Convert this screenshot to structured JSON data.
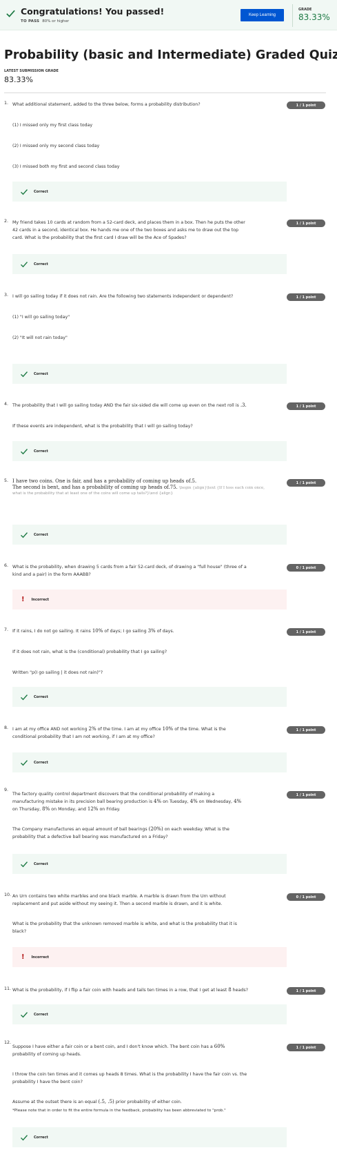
{
  "banner": {
    "title": "Congratulations! You passed!",
    "to_pass_label": "TO PASS",
    "to_pass_value": "80% or higher",
    "button": "Keep Learning",
    "grade_label": "GRADE",
    "grade_value": "83.33%"
  },
  "quiz": {
    "title": "Probability (basic and Intermediate) Graded Quiz",
    "latest_label": "LATEST SUBMISSION GRADE",
    "latest_value": "83.33%"
  },
  "labels": {
    "correct": "Correct",
    "incorrect": "Incorrect"
  },
  "questions": [
    {
      "num": "1.",
      "badge": "1 / 1 point",
      "lines": [
        "What additional statement, added to the three below, forms a probability distribution?",
        "(1) I missed only my first class today",
        "(2) I missed only my second class today",
        "(3) I missed both my first and second class today"
      ],
      "result": "correct"
    },
    {
      "num": "2.",
      "badge": "1 / 1 point",
      "lines": [
        "My friend takes 10 cards at random from a 52-card deck, and places them in a box. Then he puts the other",
        "42 cards in a second, identical box. He hands me one of the two boxes and asks me to draw out the top",
        "card. What is the probability that the first card I draw will be the Ace of Spades?"
      ],
      "result": "correct"
    },
    {
      "num": "3.",
      "badge": "1 / 1 point",
      "lines": [
        "I will go sailing today if it does not rain. Are the following two statements independent or dependent?",
        "(1) \"I will go sailing today\"",
        "(2) \"It will not rain today\""
      ],
      "result": "correct"
    },
    {
      "num": "4.",
      "badge": "1 / 1 point",
      "lines": [
        "The probability that I will go sailing today AND the fair six-sided die will come up even on the next roll is",
        ".3.",
        "If these events are independent, what is the probability that I will go sailing today?"
      ],
      "result": "correct"
    },
    {
      "num": "5.",
      "badge": "1 / 1 point",
      "lines": [
        "I have two coins. One is fair, and has a probability of coming up heads of",
        ".5.",
        "The second is bent, and has a probability of coming up heads of",
        ".75.",
        "\\begin {align}\\text {If I toss each coin once,",
        "what is the probability that at least one of the coins will come up tails?}\\end {align}"
      ],
      "result": "correct"
    },
    {
      "num": "6.",
      "badge": "0 / 1 point",
      "lines": [
        "What is the probability, when drawing 5 cards from a fair 52-card deck, of drawing a \"full house\" (three of a",
        "kind and a pair) in the form AAABB?"
      ],
      "result": "incorrect"
    },
    {
      "num": "7.",
      "badge": "1 / 1 point",
      "lines": [
        "If it rains, I do not go sailing. It rains",
        "10%",
        "of days; I go sailing",
        "3%",
        "of days.",
        "If it does not rain, what is the (conditional) probability that I go sailing?",
        "Written \"p(I go sailing | it does not rain)\"?"
      ],
      "result": "correct"
    },
    {
      "num": "8.",
      "badge": "1 / 1 point",
      "lines": [
        "I am at my office AND not working",
        "2%",
        "of the time. I am at my office",
        "10%",
        "of the time. What is the",
        "conditional probability that I am not working, if I am at my office?"
      ],
      "result": "correct"
    },
    {
      "num": "9.",
      "badge": "1 / 1 point",
      "lines": [
        "The factory quality control department discovers that the conditional probability of making a",
        "manufacturing mistake in its precision ball bearing production is",
        "4%",
        "on Tuesday,",
        "4%",
        "on Wednesday,",
        "4%",
        "on Thursday,",
        "8%",
        "on Monday, and",
        "12%",
        "on Friday.",
        "The Company manufactures an equal amount of ball bearings",
        "(20%)",
        "on each weekday. What is the",
        "probability that a defective ball bearing was manufactured on a Friday?"
      ],
      "result": "correct"
    },
    {
      "num": "10.",
      "badge": "0 / 1 point",
      "lines": [
        "An Urn contains two white marbles and one black marble. A marble is drawn from the Urn without",
        "replacement and put aside without my seeing it. Then a second marble is drawn, and it is white.",
        "What is the probability that the unknown removed marble is white, and what is the probability that it is",
        "black?"
      ],
      "result": "incorrect"
    },
    {
      "num": "11.",
      "badge": "1 / 1 point",
      "lines": [
        "What is the probability, if I flip a fair coin with heads and tails ten times in a row, that I get at least",
        "8",
        "heads?"
      ],
      "result": "correct"
    },
    {
      "num": "12.",
      "badge": "1 / 1 point",
      "lines": [
        "Suppose I have either a fair coin or a bent coin, and I don't know which. The bent coin has a",
        "60%",
        "probability of coming up heads.",
        "I throw the coin ten times and it comes up heads 8 times. What is the probability I have the fair coin vs. the",
        "probability I have the bent coin?",
        "Assume at the outset there is an equal",
        "(.5, .5)",
        "prior probability of either coin.",
        "*Please note that in order to fit the entire formula in the feedback, probability has been abbreviated to \"prob.\""
      ],
      "result": "correct"
    }
  ],
  "colors": {
    "accent": "#0056d2",
    "pass_green": "#1d7a44",
    "badge": "#636363",
    "correct_bg": "#f1f8f4",
    "incorrect_bg": "#fdf1f1"
  }
}
